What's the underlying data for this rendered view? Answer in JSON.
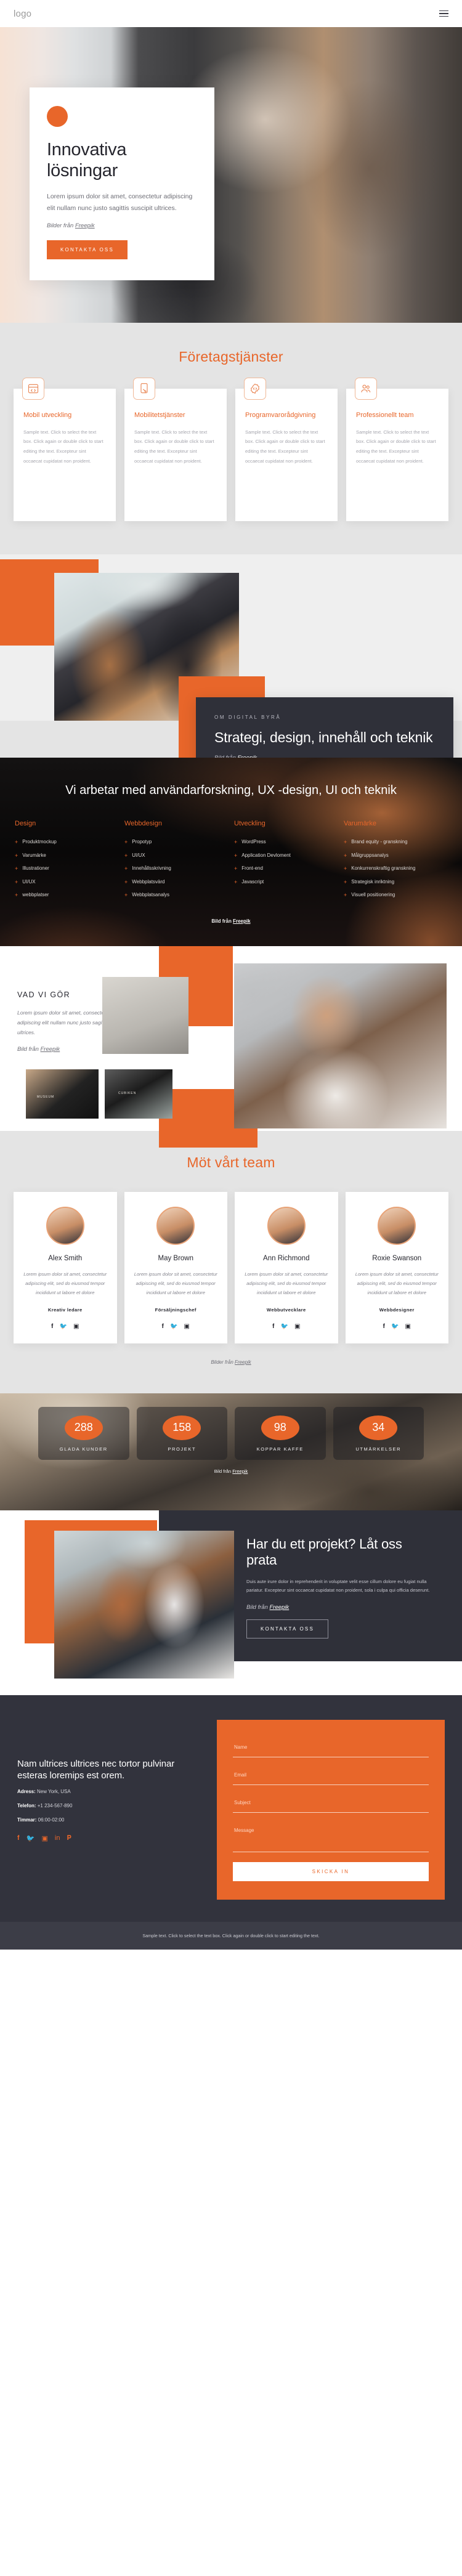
{
  "header": {
    "logo": "logo",
    "menu_icon": "hamburger-icon"
  },
  "hero": {
    "title_line1": "Innovativa",
    "title_line2": "lösningar",
    "subtitle": "Lorem ipsum dolor sit amet, consectetur adipiscing elit nullam nunc justo sagittis suscipit ultrices.",
    "credit_prefix": "Bilder från ",
    "credit_link": "Freepik",
    "cta": "KONTAKTA OSS"
  },
  "services": {
    "title": "Företagstjänster",
    "body": "Sample text. Click to select the text box. Click again or double click to start editing the text. Excepteur sint occaecat cupidatat non proident.",
    "items": [
      {
        "icon": "code-window-icon",
        "title": "Mobil utveckling"
      },
      {
        "icon": "mobile-tap-icon",
        "title": "Mobilitetstjänster"
      },
      {
        "icon": "gear-code-icon",
        "title": "Programvarorådgivning"
      },
      {
        "icon": "people-group-icon",
        "title": "Professionellt team"
      }
    ]
  },
  "about": {
    "eyebrow": "OM DIGITAL BYRÅ",
    "title": "Strategi, design, innehåll och teknik",
    "credit_prefix": "Bild från ",
    "credit_link": "Freepik"
  },
  "work": {
    "title": "Vi arbetar med användarforskning, UX -design, UI och teknik",
    "credit_prefix": "Bild från ",
    "credit_link": "Freepik",
    "columns": [
      {
        "heading": "Design",
        "items": [
          "Produktmockup",
          "Varumärke",
          "Illustrationer",
          "UI/UX",
          "webbplatser"
        ]
      },
      {
        "heading": "Webbdesign",
        "items": [
          "Propotyp",
          "UI/UX",
          "Innehållsskrivning",
          "Webbplatsvärd",
          "Webbplatsanalys"
        ]
      },
      {
        "heading": "Utveckling",
        "items": [
          "WordPress",
          "Application Devloment",
          "Front-end",
          "Javascript"
        ]
      },
      {
        "heading": "Varumärke",
        "items": [
          "Brand equity - granskning",
          "Målgruppsanalys",
          "Konkurrenskraftig granskning",
          "Strategisk inriktning",
          "Visuell positionering"
        ]
      }
    ]
  },
  "what_we_do": {
    "title": "VAD VI GÖR",
    "body": "Lorem ipsum dolor sit amet, consectetur adipiscing elit nullam nunc justo sagittis suscipit ultrices.",
    "credit_prefix": "Bild från ",
    "credit_link": "Freepik",
    "image_labels": [
      "MUSEUM",
      "CUBIKEN"
    ]
  },
  "team": {
    "title": "Möt vårt team",
    "bio": "Lorem ipsum dolor sit amet, consectetur adipiscing elit, sed do eiusmod tempor incididunt ut labore et dolore",
    "credit_prefix": "Bilder från ",
    "credit_link": "Freepik",
    "socials": [
      "facebook-icon",
      "twitter-icon",
      "instagram-icon"
    ],
    "members": [
      {
        "name": "Alex Smith",
        "role": "Kreativ ledare"
      },
      {
        "name": "May Brown",
        "role": "Försäljningschef"
      },
      {
        "name": "Ann Richmond",
        "role": "Webbutvecklare"
      },
      {
        "name": "Roxie Swanson",
        "role": "Webbdesigner"
      }
    ]
  },
  "stats": {
    "credit_prefix": "Bild från ",
    "credit_link": "Freepik",
    "items": [
      {
        "value": "288",
        "label": "GLADA KUNDER"
      },
      {
        "value": "158",
        "label": "PROJEKT"
      },
      {
        "value": "98",
        "label": "KOPPAR KAFFE"
      },
      {
        "value": "34",
        "label": "UTMÄRKELSER"
      }
    ]
  },
  "cta": {
    "title": "Har du ett projekt? Låt oss prata",
    "body": "Duis aute irure dolor in reprehenderit in voluptate velit esse cillum dolore eu fugiat nulla pariatur. Excepteur sint occaecat cupidatat non proident, sola i culpa qui officia deserunt.",
    "credit_prefix": "Bild från ",
    "credit_link": "Freepik",
    "button": "KONTAKTA OSS"
  },
  "footer": {
    "heading": "Nam ultrices ultrices nec tortor pulvinar esteras loremips est orem.",
    "address_label": "Adress:",
    "address_value": " New York, USA",
    "phone_label": "Telefon:",
    "phone_value": " +1 234-567-890",
    "hours_label": "Timmar:",
    "hours_value": " 06:00-02:00",
    "socials": [
      "facebook-icon",
      "twitter-icon",
      "instagram-icon",
      "linkedin-icon",
      "pinterest-icon"
    ],
    "form": {
      "name_placeholder": "Name",
      "email_placeholder": "Email",
      "subject_placeholder": "Subject",
      "message_placeholder": "Message",
      "submit": "SKICKA IN"
    },
    "bottom_text": "Sample text. Click to select the text box. Click again or double click to start editing the text."
  },
  "colors": {
    "accent": "#e8662a",
    "dark": "#2f3039",
    "grey": "#e4e4e4"
  }
}
